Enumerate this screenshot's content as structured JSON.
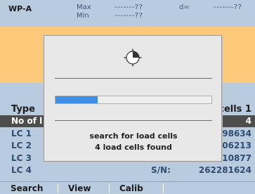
{
  "header": {
    "title": "WP-A",
    "max_label": "Max",
    "min_label": "Min",
    "max_value": "-------??",
    "min_value": "-------??",
    "d_label": "d=",
    "d_value": "-------??"
  },
  "table": {
    "header": {
      "left": "Type",
      "right": "cells 1"
    },
    "rows": [
      {
        "left": "No of l",
        "right": "4",
        "selected": true
      },
      {
        "left": "LC 1",
        "right": "98634"
      },
      {
        "left": "LC 2",
        "right": "06213"
      },
      {
        "left": "LC 3",
        "right": "10877"
      },
      {
        "left": "LC 4",
        "sn": "S/N:",
        "right": "262281624"
      }
    ]
  },
  "footer": {
    "tabs": [
      "Search",
      "View",
      "Calib"
    ]
  },
  "dialog": {
    "icon": "clock-icon",
    "progress": 0.27,
    "progress_color": "#3e8ee6",
    "message_line1": "search for load cells",
    "message_line2": "4 load cells found"
  },
  "colors": {
    "background": "#b9cbde",
    "accent_band": "#fcc87a",
    "selected_row": "#4d4d4d"
  }
}
